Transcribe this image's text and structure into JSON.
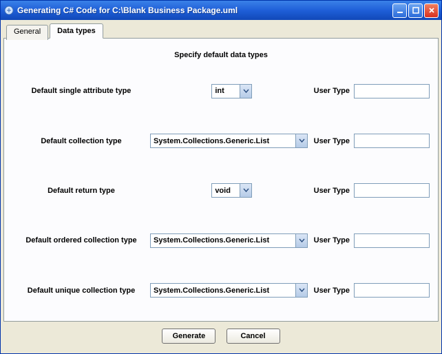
{
  "window": {
    "title": "Generating C# Code for C:\\Blank Business Package.uml"
  },
  "tabs": {
    "general": "General",
    "datatypes": "Data types"
  },
  "heading": "Specify default data types",
  "fields": {
    "singleAttr": {
      "label": "Default single attribute type",
      "value": "int",
      "userTypeLabel": "User Type",
      "userTypeValue": ""
    },
    "collection": {
      "label": "Default collection type",
      "value": "System.Collections.Generic.List",
      "userTypeLabel": "User Type",
      "userTypeValue": ""
    },
    "returnType": {
      "label": "Default return type",
      "value": "void",
      "userTypeLabel": "User Type",
      "userTypeValue": ""
    },
    "orderedCollection": {
      "label": "Default ordered collection type",
      "value": "System.Collections.Generic.List",
      "userTypeLabel": "User Type",
      "userTypeValue": ""
    },
    "uniqueCollection": {
      "label": "Default unique collection type",
      "value": "System.Collections.Generic.List",
      "userTypeLabel": "User Type",
      "userTypeValue": ""
    }
  },
  "buttons": {
    "generate": "Generate",
    "cancel": "Cancel"
  }
}
